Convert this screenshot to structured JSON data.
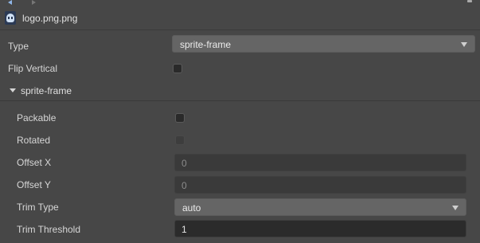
{
  "asset": {
    "file_name": "logo.png.png",
    "icon": "image-asset-icon"
  },
  "fields": {
    "type": {
      "label": "Type",
      "value": "sprite-frame"
    },
    "flip_vertical": {
      "label": "Flip Vertical",
      "checked": false
    }
  },
  "sprite_frame_section": {
    "title": "sprite-frame",
    "expanded": true,
    "packable": {
      "label": "Packable",
      "checked": false
    },
    "rotated": {
      "label": "Rotated",
      "checked": false,
      "disabled": true
    },
    "offset_x": {
      "label": "Offset X",
      "value": "0"
    },
    "offset_y": {
      "label": "Offset Y",
      "value": "0"
    },
    "trim_type": {
      "label": "Trim Type",
      "value": "auto"
    },
    "trim_threshold": {
      "label": "Trim Threshold",
      "value": "1"
    }
  },
  "colors": {
    "panel_bg": "#474747",
    "select_bg": "#656565",
    "input_bg": "#3a3a3a",
    "text": "#d6d6d6"
  }
}
